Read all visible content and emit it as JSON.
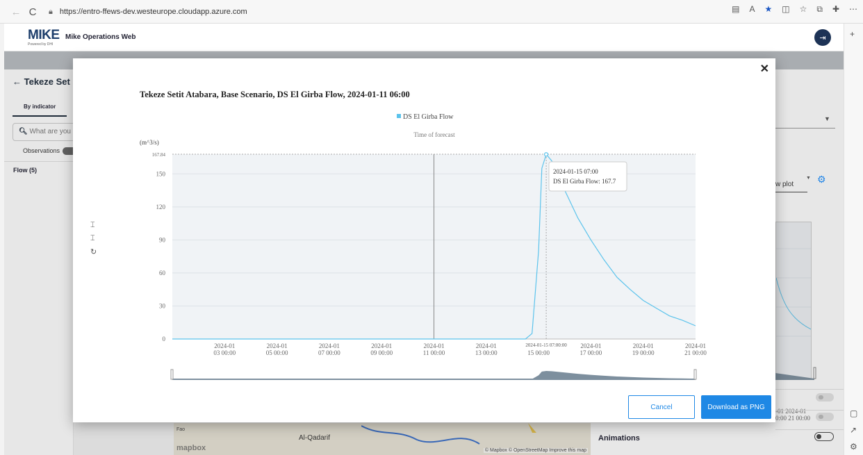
{
  "browser": {
    "url": "https://entro-ffews-dev.westeurope.cloudapp.azure.com",
    "back_icon": "back-arrow-icon",
    "refresh_icon": "refresh-icon"
  },
  "app": {
    "logo_text": "MIKE",
    "logo_sub": "Powered by DHI",
    "title": "Mike Operations Web",
    "user_icon": "exit-icon"
  },
  "background": {
    "back_title": "Tekeze Set",
    "tab_label": "By indicator",
    "search_placeholder": "What are you",
    "observations_label": "Observations",
    "flow_label": "Flow (5)",
    "view_plot_label": "w plot",
    "mini_ticks_line1": "-01   2024-01",
    "mini_ticks_line2": "0:00   21 00:00",
    "animations_label": "Animations",
    "map_fao": "Fao",
    "map_city": "Al-Qadarif",
    "map_logo": "mapbox",
    "map_credits": "© Mapbox © OpenStreetMap Improve this map"
  },
  "modal": {
    "title": "Tekeze Setit Atabara, Base Scenario, DS El Girba Flow, 2024-01-11 06:00",
    "cancel_label": "Cancel",
    "download_label": "Download as PNG",
    "close_icon": "close-icon"
  },
  "colors": {
    "series": "#5bc3ec",
    "primary": "#1e88e5",
    "plot_bg": "#f0f3f6"
  },
  "chart_data": {
    "type": "line",
    "title": "",
    "legend": [
      "DS El Girba Flow"
    ],
    "legend_position": "top-center",
    "ylabel": "(m^3/s)",
    "ylim": [
      0,
      167.84
    ],
    "yticks": [
      0,
      30,
      60,
      90,
      120,
      150
    ],
    "ymax_label": "167.84",
    "xlim": [
      "2024-01-01 00:00",
      "2024-01-21 00:00"
    ],
    "xticks": [
      [
        "2024-01",
        "03 00:00"
      ],
      [
        "2024-01",
        "05 00:00"
      ],
      [
        "2024-01",
        "07 00:00"
      ],
      [
        "2024-01",
        "09 00:00"
      ],
      [
        "2024-01",
        "11 00:00"
      ],
      [
        "2024-01",
        "13 00:00"
      ],
      [
        "2024-01",
        "15 00:00"
      ],
      [
        "2024-01",
        "17 00:00"
      ],
      [
        "2024-01",
        "19 00:00"
      ],
      [
        "2024-01",
        "21 00:00"
      ]
    ],
    "markline": {
      "label": "Time of forecast",
      "x": "2024-01-11 00:00"
    },
    "crosshair_label": "2024-01-15 07:00:00",
    "tooltip": {
      "time": "2024-01-15 07:00",
      "series": "DS El Girba Flow",
      "value": "167.7"
    },
    "series": [
      {
        "name": "DS El Girba Flow",
        "x": [
          "2024-01-01 00:00",
          "2024-01-14 12:00",
          "2024-01-14 18:00",
          "2024-01-15 00:00",
          "2024-01-15 03:00",
          "2024-01-15 07:00",
          "2024-01-15 12:00",
          "2024-01-16 00:00",
          "2024-01-16 12:00",
          "2024-01-17 00:00",
          "2024-01-17 12:00",
          "2024-01-18 00:00",
          "2024-01-18 12:00",
          "2024-01-19 00:00",
          "2024-01-19 12:00",
          "2024-01-20 00:00",
          "2024-01-20 12:00",
          "2024-01-21 00:00"
        ],
        "y": [
          0,
          0,
          5,
          80,
          155,
          167.7,
          162,
          135,
          110,
          90,
          72,
          56,
          45,
          35,
          28,
          21,
          17,
          12
        ]
      }
    ]
  }
}
